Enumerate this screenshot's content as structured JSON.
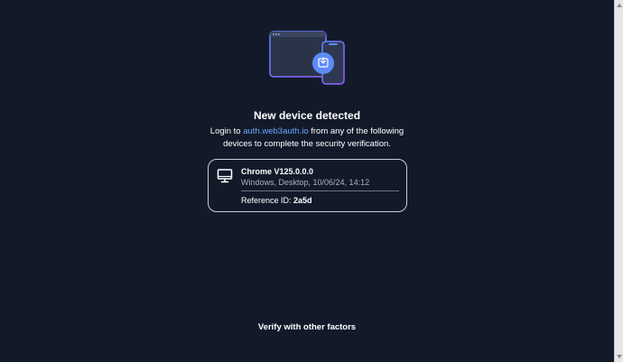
{
  "header": {
    "title": "New device detected"
  },
  "description": {
    "prefix": "Login to ",
    "link_text": "auth.web3auth.io",
    "suffix": " from any of the following devices to complete the security verification."
  },
  "device": {
    "icon": "desktop-monitor-icon",
    "name": "Chrome V125.0.0.0",
    "info": "Windows, Desktop, 10/06/24, 14:12",
    "reference_label": "Reference ID: ",
    "reference_value": "2a5d"
  },
  "footer": {
    "verify_label": "Verify with other factors"
  },
  "colors": {
    "background": "#121a2a",
    "accent": "#6ea8ff",
    "illustration_stroke": "#7b6cff"
  },
  "illustration": {
    "icon": "device-sync-illustration"
  }
}
